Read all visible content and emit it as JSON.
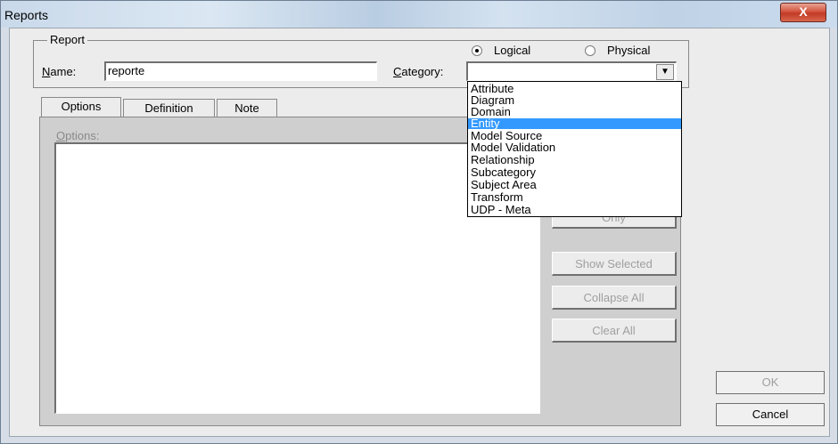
{
  "window": {
    "title": "Reports",
    "close_glyph": "X"
  },
  "report_group": {
    "legend": "Report",
    "name_label_accel": "N",
    "name_label_rest": "ame:",
    "name_value": "reporte",
    "category_label_accel": "C",
    "category_label_rest": "ategory:",
    "category_value": "",
    "mode_options": [
      {
        "label": "Logical",
        "selected": true
      },
      {
        "label": "Physical",
        "selected": false
      }
    ]
  },
  "category_dropdown": {
    "items": [
      "Attribute",
      "Diagram",
      "Domain",
      "Entity",
      "Model Source",
      "Model Validation",
      "Relationship",
      "Subcategory",
      "Subject Area",
      "Transform",
      "UDP - Meta"
    ],
    "highlighted": "Entity"
  },
  "tabs": [
    {
      "label": "Options",
      "active": true
    },
    {
      "label": "Definition",
      "active": false
    },
    {
      "label": "Note",
      "active": false
    }
  ],
  "options_panel": {
    "label_accel": "O",
    "label_rest": "ptions:",
    "buttons": {
      "only": "Only",
      "show_selected": "Show Selected",
      "collapse_all": "Collapse All",
      "clear_all": "Clear All"
    }
  },
  "dialog_buttons": {
    "ok": "OK",
    "cancel": "Cancel"
  },
  "icons": {
    "close": "close-icon",
    "dropdown_arrow": "chevron-down-icon"
  }
}
